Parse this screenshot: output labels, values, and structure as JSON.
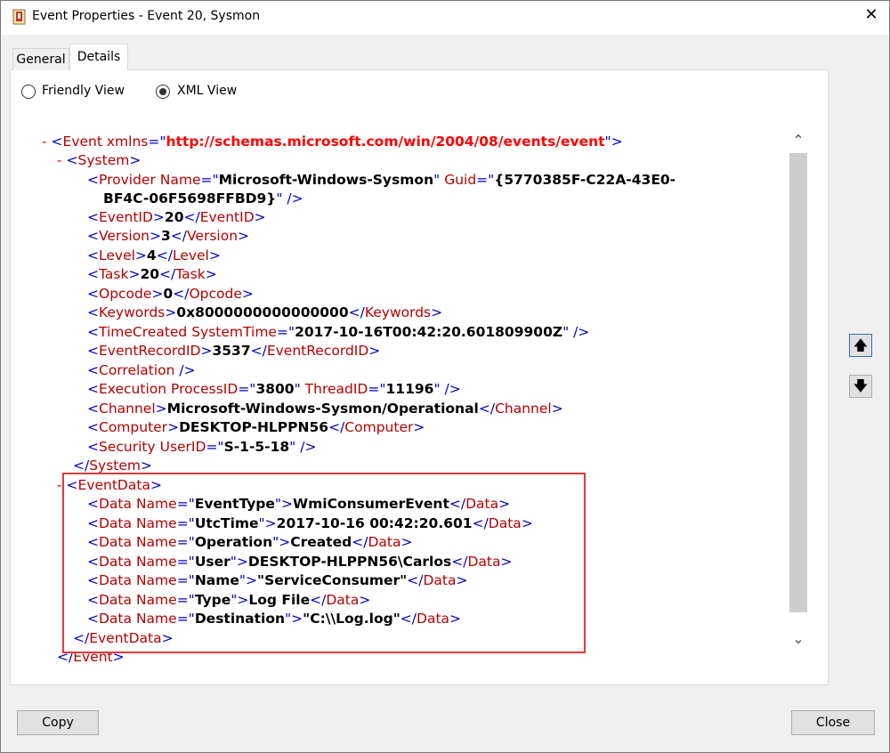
{
  "window": {
    "title": "Event Properties - Event 20, Sysmon",
    "close_glyph": "✕",
    "app_icon": "event-viewer-icon"
  },
  "tabs": [
    {
      "label": "General",
      "active": false
    },
    {
      "label": "Details",
      "active": true
    }
  ],
  "view_options": {
    "friendly": {
      "label": "Friendly View",
      "checked": false
    },
    "xml": {
      "label": "XML View",
      "checked": true
    }
  },
  "xml": {
    "event_xmlns_attr": "xmlns",
    "event_xmlns": "http://schemas.microsoft.com/win/2004/08/events/event",
    "provider_name": "Microsoft-Windows-Sysmon",
    "provider_guid_1": "{5770385F-C22A-43E0-",
    "provider_guid_2": "BF4C-06F5698FFBD9}",
    "event_id": "20",
    "version": "3",
    "level": "4",
    "task": "20",
    "opcode": "0",
    "keywords": "0x8000000000000000",
    "time_created": "2017-10-16T00:42:20.601809900Z",
    "event_record_id": "3537",
    "process_id": "3800",
    "thread_id": "11196",
    "channel": "Microsoft-Windows-Sysmon/Operational",
    "computer": "DESKTOP-HLPPN56",
    "security_user_id": "S-1-5-18",
    "event_data": [
      {
        "name": "EventType",
        "value": "WmiConsumerEvent"
      },
      {
        "name": "UtcTime",
        "value": "2017-10-16 00:42:20.601"
      },
      {
        "name": "Operation",
        "value": "Created"
      },
      {
        "name": "User",
        "value": "DESKTOP-HLPPN56\\Carlos"
      },
      {
        "name": "Name",
        "value": "\"ServiceConsumer\""
      },
      {
        "name": "Type",
        "value": "Log File"
      },
      {
        "name": "Destination",
        "value": "\"C:\\\\Log.log\""
      }
    ]
  },
  "scrollbar": {
    "up_glyph": "⌃",
    "down_glyph": "⌄"
  },
  "nav": {
    "up_glyph": "🡅",
    "down_glyph": "🡇"
  },
  "buttons": {
    "copy": "Copy",
    "close": "Close"
  },
  "colors": {
    "highlight": "#e23b3b",
    "tag": "#0000cc",
    "name": "#b50000",
    "url": "#ff0000"
  }
}
